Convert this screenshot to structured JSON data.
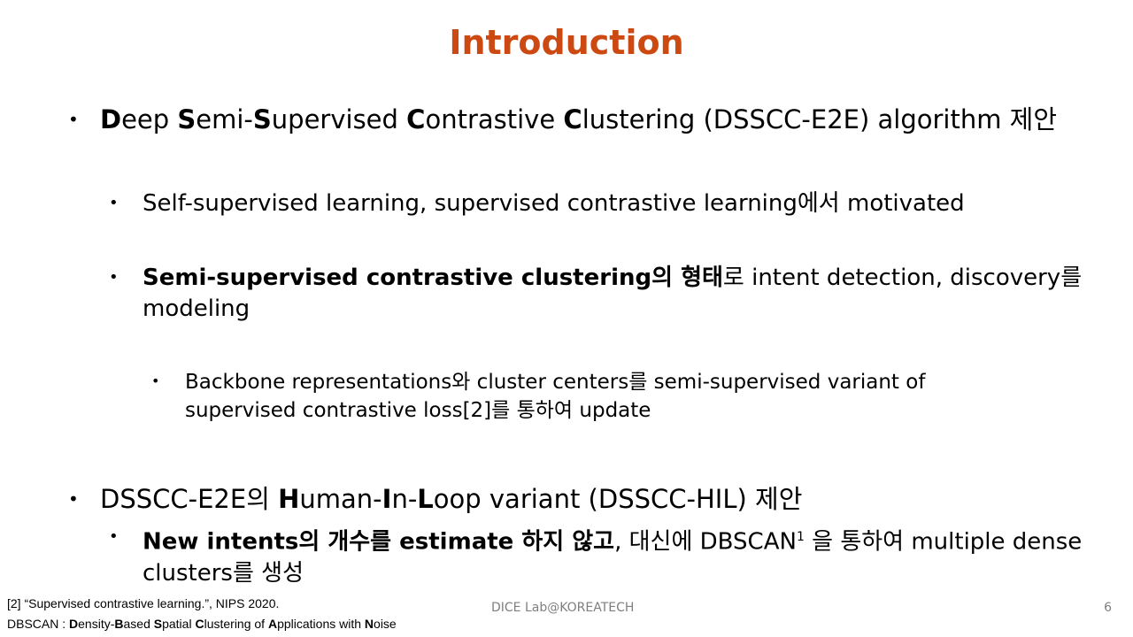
{
  "slide": {
    "title": "Introduction",
    "b1": {
      "p1": "D",
      "p2": "eep ",
      "p3": "S",
      "p4": "emi-",
      "p5": "S",
      "p6": "upervised ",
      "p7": "C",
      "p8": "ontrastive ",
      "p9": "C",
      "p10": "lustering (DSSCC-E2E) algorithm 제안"
    },
    "b1_1": "Self-supervised learning, supervised contrastive learning에서 motivated",
    "b1_2": {
      "bold": "Semi-supervised contrastive clustering의 형태",
      "rest": "로 intent detection, discovery를 modeling"
    },
    "b1_2_1": "Backbone representations와 cluster centers를 semi-supervised variant of supervised contrastive loss[2]를 통하여 update",
    "b2": {
      "p1": "DSSCC-E2E의 ",
      "p2": "H",
      "p3": "uman-",
      "p4": "I",
      "p5": "n-",
      "p6": "L",
      "p7": "oop variant (DSSCC-HIL) 제안"
    },
    "b2_1": {
      "bold": "New intents의 개수를 estimate 하지 않고",
      "rest1": ", 대신에 DBSCAN",
      "sup": "1",
      "rest2": " 을 통하여 multiple dense clusters를 생성"
    }
  },
  "footer": {
    "ref": "[2] “Supervised contrastive learning.”, NIPS 2020.",
    "dbscan": {
      "p1": "DBSCAN : ",
      "p2": "D",
      "p3": "ensity-",
      "p4": "B",
      "p5": "ased ",
      "p6": "S",
      "p7": "patial ",
      "p8": "C",
      "p9": "lustering of ",
      "p10": "A",
      "p11": "pplications with ",
      "p12": "N",
      "p13": "oise"
    },
    "lab": "DICE Lab@KOREATECH",
    "page": "6"
  },
  "colors": {
    "title": "#cc4a12",
    "footer_gray": "#7f7f7f"
  }
}
